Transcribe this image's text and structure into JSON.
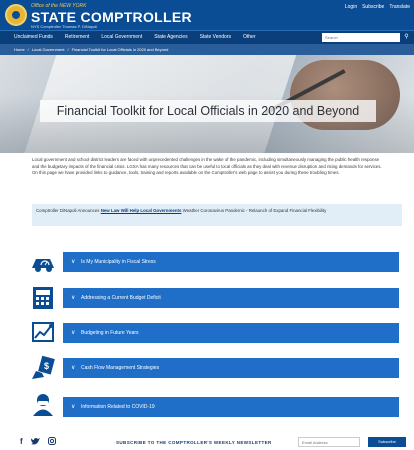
{
  "header": {
    "office_line": "Office of the NEW YORK",
    "title": "STATE COMPTROLLER",
    "subtitle": "NYS Comptroller Thomas P. DiNapoli",
    "util_links": [
      "Login",
      "Subscribe",
      "Translate"
    ]
  },
  "nav": {
    "items": [
      "Unclaimed Funds",
      "Retirement",
      "Local Government",
      "State Agencies",
      "State Vendors",
      "Other"
    ],
    "search_placeholder": "Search",
    "search_icon": "magnifier"
  },
  "breadcrumb": [
    "Home",
    "/",
    "Local Government",
    "/",
    "Financial Toolkit for Local Officials in 2020 and Beyond"
  ],
  "hero": {
    "title": "Financial Toolkit for Local Officials in 2020 and Beyond"
  },
  "intro": "Local government and school district leaders are faced with unprecedented challenges in the wake of the pandemic, including simultaneously managing the public health response and the budgetary impacts of the financial crisis. LGSA has many resources that can be useful to local officials as they deal with revenue disruption and rising demands for services. On this page we have provided links to guidance, tools, training and reports available on the Comptroller's web page to assist you during these troubling times.",
  "notice": {
    "prefix": "Comptroller DiNapoli Announces",
    "link": "New Law Will Help Local Governments",
    "suffix": "Weather Coronavirus Pandemic - Relaunch of Expand Financial Flexibility"
  },
  "accordion": [
    {
      "label": "Is My Municipality in Fiscal Stress",
      "icon": "car-gauge-icon"
    },
    {
      "label": "Addressing a Current Budget Deficit",
      "icon": "calculator-icon"
    },
    {
      "label": "Budgeting in Future Years",
      "icon": "chart-icon"
    },
    {
      "label": "Cash Flow Management Strategies",
      "icon": "cash-hand-icon"
    },
    {
      "label": "Information Related to COVID-19",
      "icon": "person-mask-icon"
    }
  ],
  "footer": {
    "social": [
      "f",
      "t",
      "ig"
    ],
    "newsletter_label": "SUBSCRIBE TO THE COMPTROLLER'S WEEKLY NEWSLETTER",
    "newsletter_placeholder": "Email Address",
    "newsletter_button": "Subscribe"
  },
  "colors": {
    "primary": "#0b4d94",
    "nav": "#0a3f7c",
    "accordion": "#1f6fc8",
    "accent_gold": "#e6b533"
  }
}
